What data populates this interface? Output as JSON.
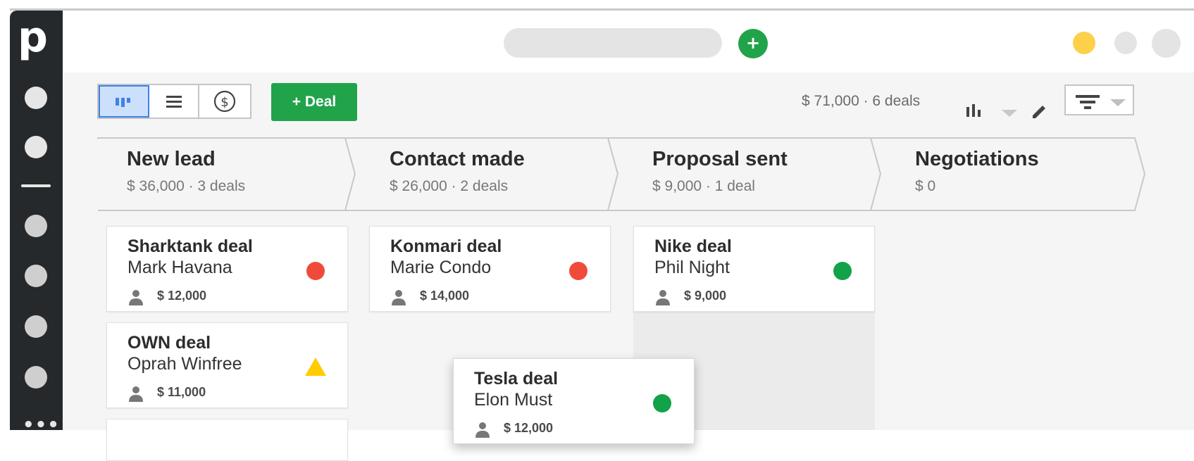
{
  "app": {
    "logo_letter": "p"
  },
  "topbar": {
    "add_label": "+"
  },
  "toolbar": {
    "deal_button": "+ Deal",
    "summary": "$ 71,000 · 6 deals",
    "view_icons": [
      "pipeline-view-icon",
      "list-view-icon",
      "forecast-view-icon"
    ]
  },
  "stages": [
    {
      "name": "New lead",
      "summary": "$ 36,000 · 3 deals"
    },
    {
      "name": "Contact made",
      "summary": "$ 26,000 · 2 deals"
    },
    {
      "name": "Proposal sent",
      "summary": "$ 9,000 · 1 deal"
    },
    {
      "name": "Negotiations",
      "summary": "$ 0"
    }
  ],
  "cards": [
    {
      "title": "Sharktank deal",
      "person": "Mark Havana",
      "value": "$ 12,000",
      "status": "red"
    },
    {
      "title": "OWN deal",
      "person": "Oprah Winfree",
      "value": "$ 11,000",
      "status": "warning"
    },
    {
      "title": "Konmari deal",
      "person": "Marie Condo",
      "value": "$ 14,000",
      "status": "red"
    },
    {
      "title": "Nike deal",
      "person": "Phil Night",
      "value": "$ 9,000",
      "status": "green"
    },
    {
      "title": "Tesla deal",
      "person": "Elon Must",
      "value": "$ 12,000",
      "status": "green"
    }
  ],
  "colors": {
    "brand_green": "#21a34a",
    "status_red": "#f04b3a",
    "status_green": "#12a24a",
    "status_yellow": "#ffcc00",
    "sidebar": "#26292c",
    "active_view": "#3f82e6"
  }
}
